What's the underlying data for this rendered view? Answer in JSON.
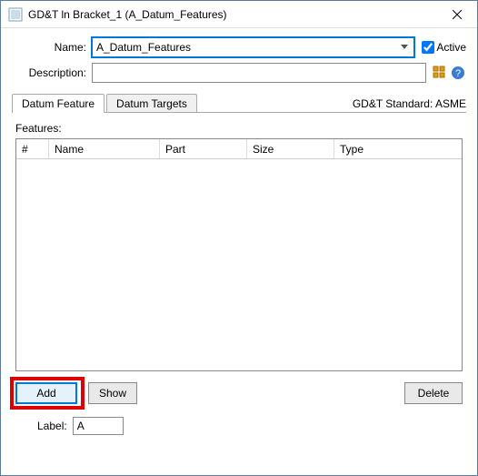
{
  "window": {
    "title": "GD&T ln Bracket_1 (A_Datum_Features)"
  },
  "form": {
    "name_label": "Name:",
    "name_value": "A_Datum_Features",
    "active_label": "Active",
    "active_checked": true,
    "description_label": "Description:",
    "description_value": ""
  },
  "tabs": {
    "items": [
      {
        "label": "Datum Feature",
        "active": true
      },
      {
        "label": "Datum Targets",
        "active": false
      }
    ]
  },
  "standard_label": "GD&T Standard: ASME",
  "features": {
    "heading": "Features:",
    "columns": {
      "num": "#",
      "name": "Name",
      "part": "Part",
      "size": "Size",
      "type": "Type"
    },
    "rows": []
  },
  "buttons": {
    "add": "Add",
    "show": "Show",
    "delete": "Delete"
  },
  "label_field": {
    "label": "Label:",
    "value": "A"
  }
}
